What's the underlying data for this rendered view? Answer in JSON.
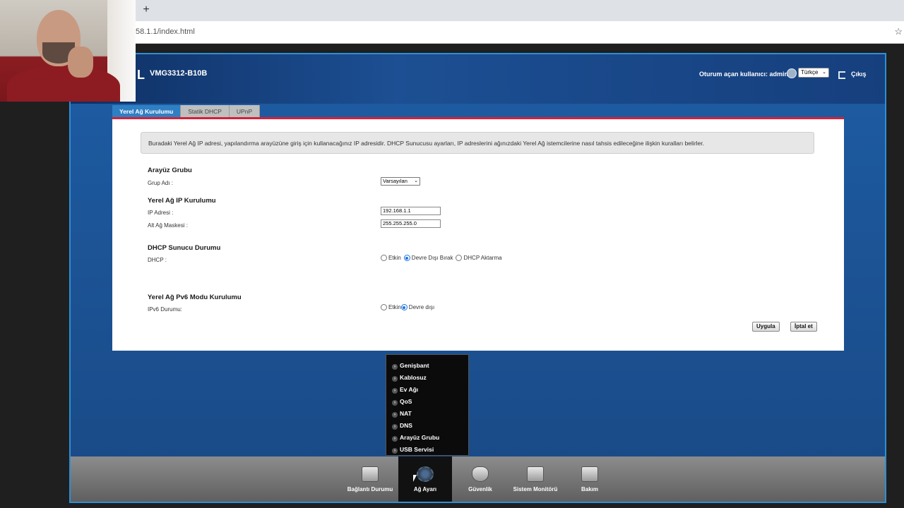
{
  "browser": {
    "url": "58.1.1/index.html",
    "new_tab": "+",
    "star": "☆"
  },
  "router": {
    "logo_fragment": "L",
    "model": "VMG3312-B10B",
    "user_label": "Oturum açan kullanıcı: admin",
    "language": "Türkçe",
    "logout": "Çıkış"
  },
  "tabs": [
    {
      "label": "Yerel Ağ Kurulumu",
      "active": true
    },
    {
      "label": "Statik DHCP",
      "active": false
    },
    {
      "label": "UPnP",
      "active": false
    }
  ],
  "info_text": "Buradaki Yerel Ağ IP adresi, yapılandırma arayüzüne giriş için kullanacağınız IP adresidir. DHCP Sunucusu ayarları, IP adreslerini ağınızdaki Yerel Ağ istemcilerine nasıl tahsis edileceğine ilişkin kuralları belirler.",
  "interface_group": {
    "title": "Arayüz Grubu",
    "group_label": "Grup Adı :",
    "group_value": "Varsayılan"
  },
  "lan_ip": {
    "title": "Yerel Ağ IP Kurulumu",
    "ip_label": "IP Adresi :",
    "ip_value": "192.168.1.1",
    "mask_label": "Alt Ağ Maskesi :",
    "mask_value": "255.255.255.0"
  },
  "dhcp": {
    "title": "DHCP Sunucu Durumu",
    "label": "DHCP :",
    "options": [
      "Etkin",
      "Devre Dışı Bırak",
      "DHCP Aktarma"
    ],
    "selected": "Devre Dışı Bırak"
  },
  "ipv6": {
    "title": "Yerel Ağ Pv6 Modu Kurulumu",
    "label": "IPv6 Durumu:",
    "options": [
      "Etkin",
      "Devre dışı"
    ],
    "selected": "Devre dışı"
  },
  "buttons": {
    "apply": "Uygula",
    "cancel": "İptal et"
  },
  "menu": [
    "Genişbant",
    "Kablosuz",
    "Ev Ağı",
    "QoS",
    "NAT",
    "DNS",
    "Arayüz Grubu",
    "USB Servisi"
  ],
  "bottom_nav": [
    {
      "label": "Bağlantı Durumu",
      "icon": "monitor-icon",
      "active": false
    },
    {
      "label": "Ağ Ayarı",
      "icon": "gear-icon",
      "active": true
    },
    {
      "label": "Güvenlik",
      "icon": "shield-icon",
      "active": false
    },
    {
      "label": "Sistem Monitörü",
      "icon": "chart-icon",
      "active": false
    },
    {
      "label": "Bakım",
      "icon": "tools-icon",
      "active": false
    }
  ]
}
